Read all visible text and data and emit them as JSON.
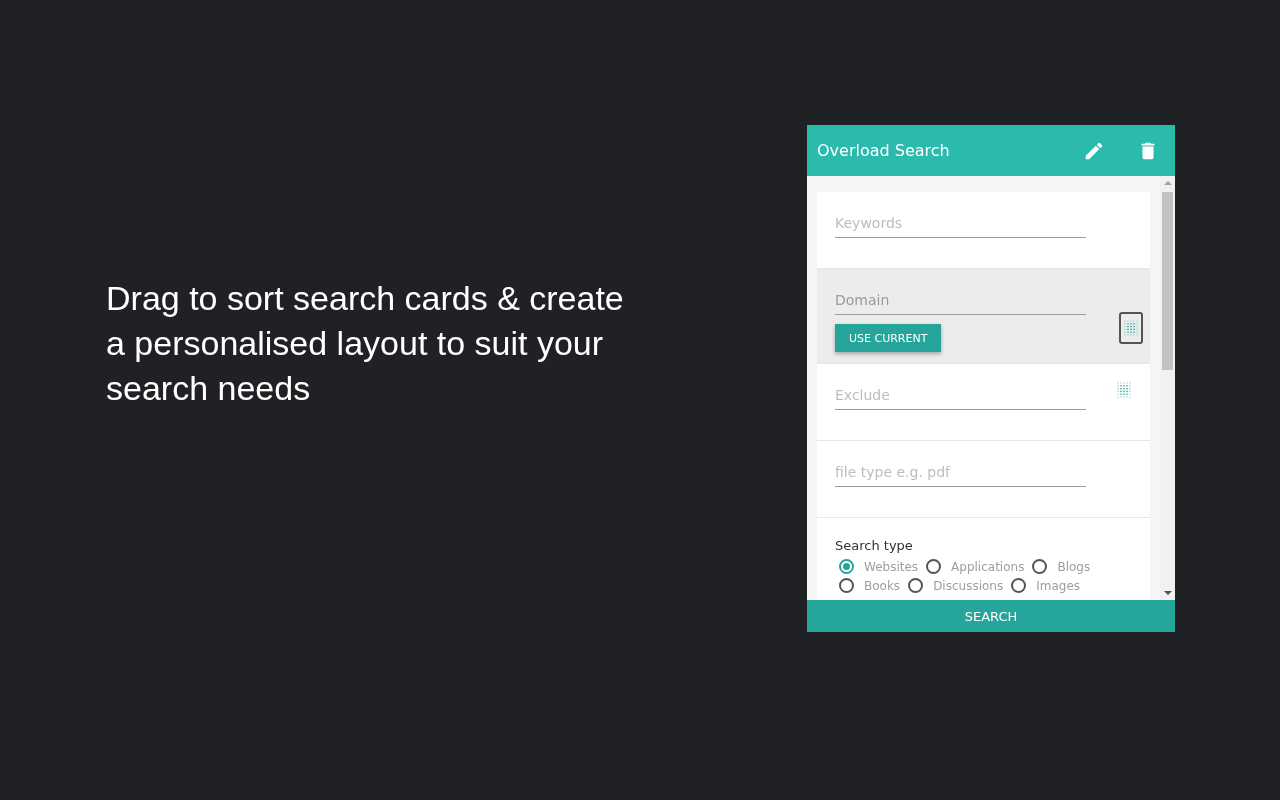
{
  "caption": "Drag to sort search cards & create a personalised layout to suit your search needs",
  "panel": {
    "title": "Overload Search",
    "cards": [
      {
        "kind": "field",
        "placeholder": "Keywords",
        "dragging": false,
        "handle": false
      },
      {
        "kind": "field",
        "placeholder": "Domain",
        "dragging": true,
        "handle": true,
        "button": "USE CURRENT"
      },
      {
        "kind": "field",
        "placeholder": "Exclude",
        "dragging": false,
        "handle": true
      },
      {
        "kind": "field",
        "placeholder": "file type e.g. pdf",
        "dragging": false,
        "handle": false
      },
      {
        "kind": "radios",
        "label": "Search type",
        "options": [
          {
            "label": "Websites",
            "selected": true
          },
          {
            "label": "Applications",
            "selected": false
          },
          {
            "label": "Blogs",
            "selected": false
          },
          {
            "label": "Books",
            "selected": false
          },
          {
            "label": "Discussions",
            "selected": false
          },
          {
            "label": "Images",
            "selected": false
          }
        ]
      }
    ],
    "search_button": "SEARCH"
  }
}
